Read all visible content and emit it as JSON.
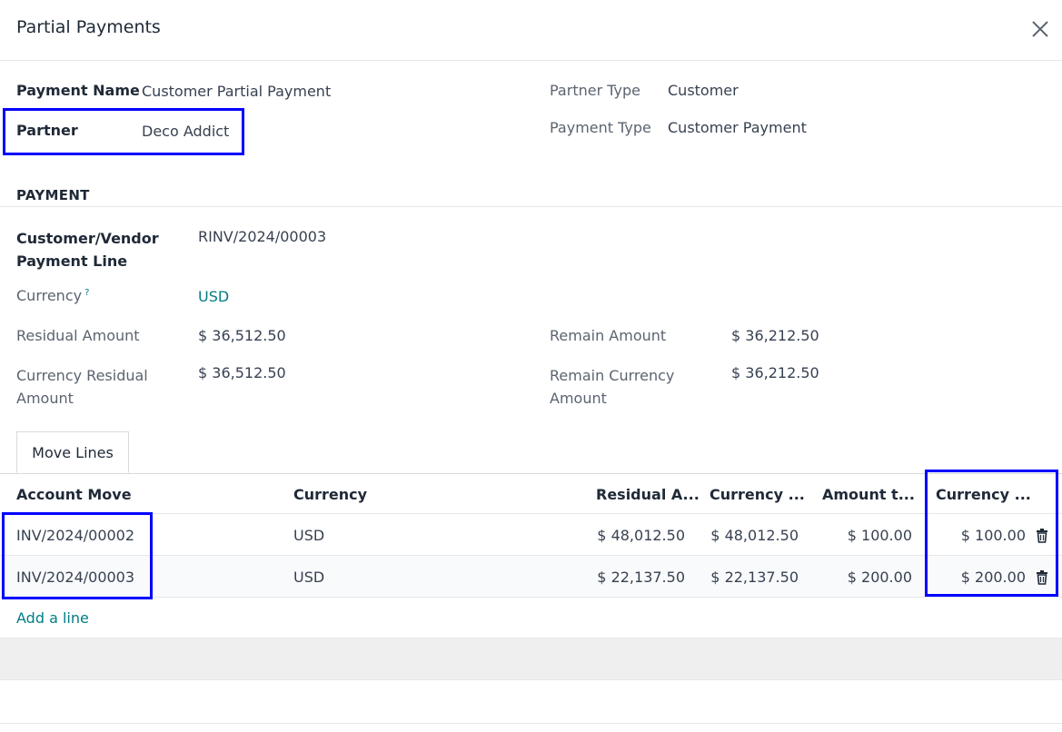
{
  "dialog": {
    "title": "Partial Payments"
  },
  "form": {
    "payment_name_label": "Payment Name",
    "payment_name_value": "Customer Partial Payment",
    "partner_label": "Partner",
    "partner_value": "Deco Addict",
    "partner_type_label": "Partner Type",
    "partner_type_value": "Customer",
    "payment_type_label": "Payment Type",
    "payment_type_value": "Customer Payment"
  },
  "payment": {
    "section_title": "PAYMENT",
    "line_label_1": "Customer/Vendor",
    "line_label_2": "Payment Line",
    "line_value": "RINV/2024/00003",
    "currency_label": "Currency",
    "currency_help": "?",
    "currency_value": "USD",
    "residual_label": "Residual Amount",
    "residual_value": "$ 36,512.50",
    "remain_label": "Remain Amount",
    "remain_value": "$ 36,212.50",
    "cur_residual_label_1": "Currency Residual",
    "cur_residual_label_2": "Amount",
    "cur_residual_value": "$ 36,512.50",
    "remain_cur_label_1": "Remain Currency",
    "remain_cur_label_2": "Amount",
    "remain_cur_value": "$ 36,212.50"
  },
  "tabs": [
    {
      "label": "Move Lines"
    }
  ],
  "table": {
    "headers": [
      "Account Move",
      "Currency",
      "Residual A...",
      "Currency ...",
      "Amount t...",
      "Currency ..."
    ],
    "rows": [
      {
        "move": "INV/2024/00002",
        "currency": "USD",
        "residual": "$ 48,012.50",
        "cur_residual": "$ 48,012.50",
        "amount": "$ 100.00",
        "cur_amount": "$ 100.00"
      },
      {
        "move": "INV/2024/00003",
        "currency": "USD",
        "residual": "$ 22,137.50",
        "cur_residual": "$ 22,137.50",
        "amount": "$ 200.00",
        "cur_amount": "$ 200.00"
      }
    ],
    "add_line": "Add a line"
  },
  "colors": {
    "accent": "#017e84",
    "highlight": "#0000ff"
  }
}
